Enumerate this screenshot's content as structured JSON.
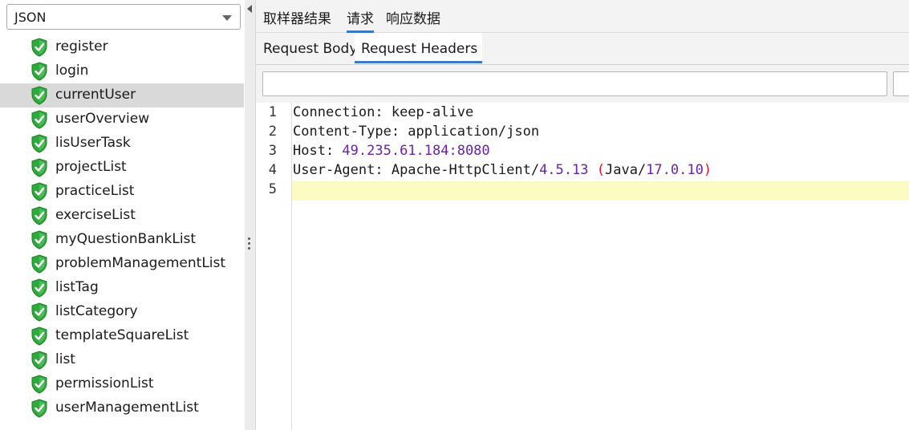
{
  "left_panel": {
    "dropdown": {
      "value": "JSON"
    },
    "tree": [
      {
        "label": "register"
      },
      {
        "label": "login"
      },
      {
        "label": "currentUser"
      },
      {
        "label": "userOverview"
      },
      {
        "label": "lisUserTask"
      },
      {
        "label": "projectList"
      },
      {
        "label": "practiceList"
      },
      {
        "label": "exerciseList"
      },
      {
        "label": " myQuestionBankList"
      },
      {
        "label": "problemManagementList"
      },
      {
        "label": "listTag"
      },
      {
        "label": "listCategory"
      },
      {
        "label": "templateSquareList"
      },
      {
        "label": "list"
      },
      {
        "label": "permissionList"
      },
      {
        "label": "userManagementList"
      }
    ],
    "selected_index": 2
  },
  "top_tabs": [
    "取样器结果",
    "请求",
    "响应数据"
  ],
  "top_tabs_active": 1,
  "sub_tabs": [
    "Request Body",
    "Request Headers"
  ],
  "sub_tabs_active": 1,
  "search": {
    "value": ""
  },
  "editor": {
    "line_numbers": [
      "1",
      "2",
      "3",
      "4",
      "5"
    ],
    "lines": [
      {
        "key": "Connection: ",
        "parts": [
          {
            "t": "keep-alive",
            "c": "k"
          }
        ]
      },
      {
        "key": "Content-Type: ",
        "parts": [
          {
            "t": "application/json",
            "c": "k"
          }
        ]
      },
      {
        "key": "Host: ",
        "parts": [
          {
            "t": "49.235.61.184:8080",
            "c": "num"
          }
        ]
      },
      {
        "key": "User-Agent: ",
        "parts": [
          {
            "t": "Apache-HttpClient/",
            "c": "k"
          },
          {
            "t": "4.5.13",
            "c": "num"
          },
          {
            "t": " ",
            "c": "k"
          },
          {
            "t": "(",
            "c": "paren"
          },
          {
            "t": "Java/",
            "c": "k"
          },
          {
            "t": "17.0.10",
            "c": "num"
          },
          {
            "t": ")",
            "c": "paren"
          }
        ]
      },
      {
        "key": "",
        "parts": []
      }
    ],
    "highlight_line": 5
  },
  "colors": {
    "accent": "#3c78c8",
    "shield_green": "#2eaa3c",
    "number": "#6d1fb0",
    "paren": "#e0141e",
    "highlight": "#fdfbc4"
  }
}
